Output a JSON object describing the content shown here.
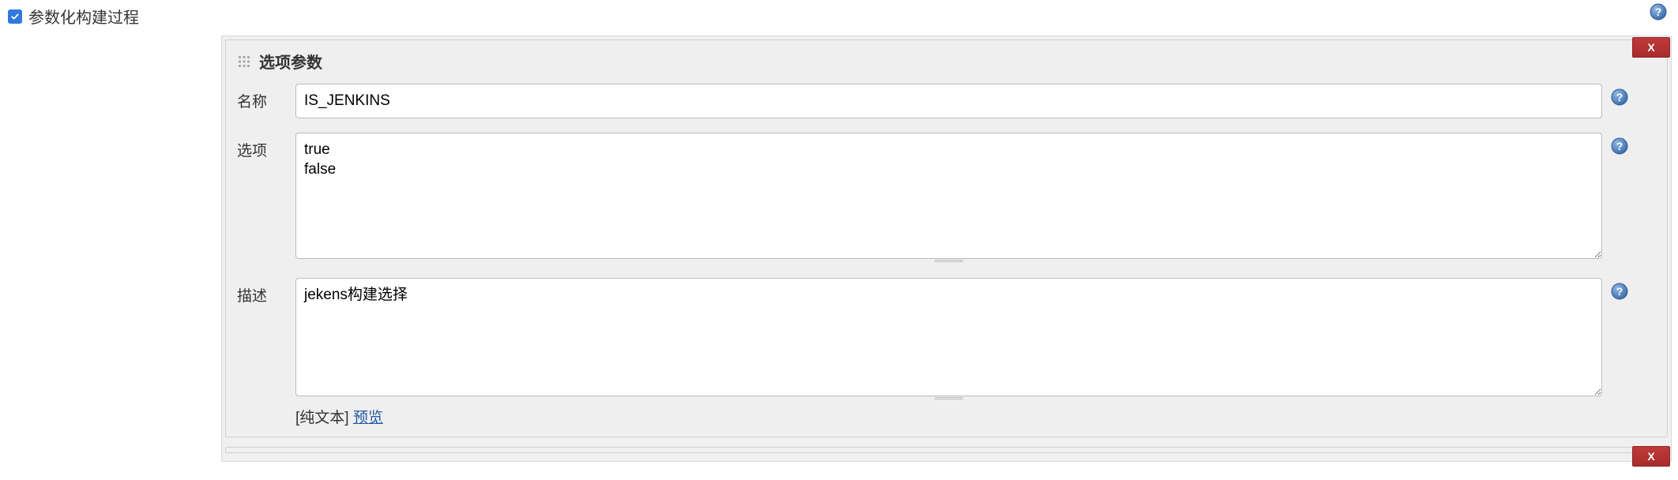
{
  "section": {
    "checkbox_label": "参数化构建过程",
    "checked": true
  },
  "block": {
    "title": "选项参数",
    "delete_label": "X",
    "rows": {
      "name": {
        "label": "名称",
        "value": "IS_JENKINS"
      },
      "choices": {
        "label": "选项",
        "value": "true\nfalse"
      },
      "description": {
        "label": "描述",
        "value": "jekens构建选择",
        "format_prefix": "[纯文本] ",
        "preview_link": "预览"
      }
    }
  },
  "peek": {
    "delete_label": "X"
  }
}
